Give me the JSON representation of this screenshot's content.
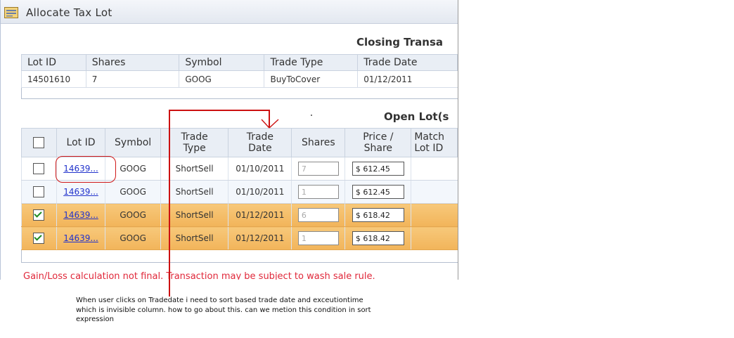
{
  "window": {
    "title": "Allocate Tax Lot"
  },
  "closing": {
    "section_title": "Closing Transa",
    "headers": [
      "Lot ID",
      "Shares",
      "Symbol",
      "Trade Type",
      "Trade Date"
    ],
    "row": [
      "14501610",
      "7",
      "GOOG",
      "BuyToCover",
      "01/12/2011"
    ]
  },
  "open": {
    "section_title": "Open Lot(s",
    "headers": {
      "lot_id": "Lot ID",
      "symbol": "Symbol",
      "trade_type_1": "Trade",
      "trade_type_2": "Type",
      "trade_date_1": "Trade",
      "trade_date_2": "Date",
      "shares": "Shares",
      "price_1": "Price /",
      "price_2": "Share",
      "match_1": "Match",
      "match_2": "Lot ID"
    },
    "rows": [
      {
        "lot": "14639...",
        "symbol": "GOOG",
        "type": "ShortSell",
        "date": "01/10/2011",
        "shares": "7",
        "price": "$ 612.45"
      },
      {
        "lot": "14639...",
        "symbol": "GOOG",
        "type": "ShortSell",
        "date": "01/10/2011",
        "shares": "1",
        "price": "$ 612.45"
      },
      {
        "lot": "14639...",
        "symbol": "GOOG",
        "type": "ShortSell",
        "date": "01/12/2011",
        "shares": "6",
        "price": "$ 618.42"
      },
      {
        "lot": "14639...",
        "symbol": "GOOG",
        "type": "ShortSell",
        "date": "01/12/2011",
        "shares": "1",
        "price": "$ 618.42"
      }
    ]
  },
  "warning": "Gain/Loss calculation not final. Transaction may be subject to wash sale rule.",
  "note": "When user clicks on Tradedate i need to sort based trade date and exceutiontime which is invisible column. how to go about this. can we metion this condition in sort expression",
  "colors": {
    "selected_row": "#f2b45a",
    "annotation": "#cc1111",
    "warning_text": "#e0283a"
  }
}
